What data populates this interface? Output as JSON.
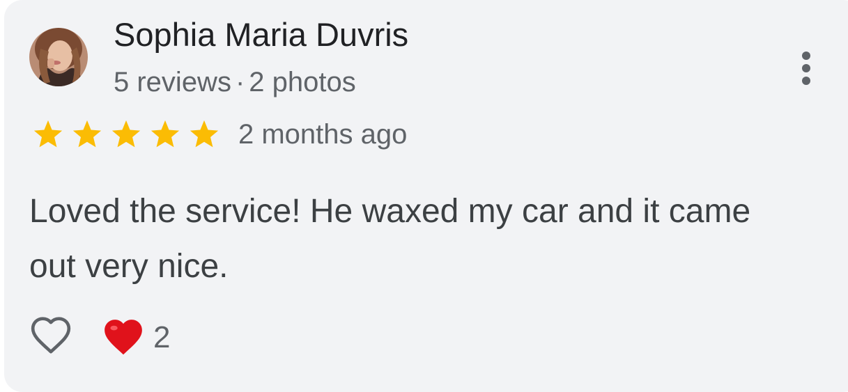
{
  "review": {
    "author_name": "Sophia Maria Duvris",
    "reviews_count": "5 reviews",
    "separator": "·",
    "photos_count": "2 photos",
    "rating": 5,
    "rating_max": 5,
    "date": "2 months ago",
    "text": "Loved the service! He waxed my car and it came out very nice.",
    "reactions": {
      "like_icon": "heart-outline-icon",
      "reaction_icon": "red-heart-icon",
      "count": "2"
    }
  },
  "colors": {
    "card_background": "#f2f3f5",
    "star": "#fbbc04",
    "heart": "#e0121b",
    "primary_text": "#202124",
    "secondary_text": "#5f6368"
  }
}
